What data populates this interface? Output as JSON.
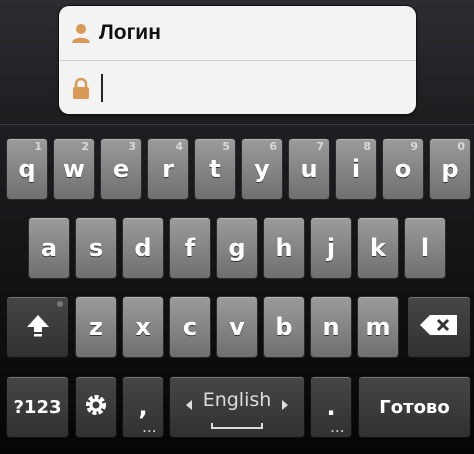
{
  "login": {
    "username_label": "Логин",
    "password_value": ""
  },
  "keyboard": {
    "row1": [
      {
        "key": "q",
        "hint": "1"
      },
      {
        "key": "w",
        "hint": "2"
      },
      {
        "key": "e",
        "hint": "3"
      },
      {
        "key": "r",
        "hint": "4"
      },
      {
        "key": "t",
        "hint": "5"
      },
      {
        "key": "y",
        "hint": "6"
      },
      {
        "key": "u",
        "hint": "7"
      },
      {
        "key": "i",
        "hint": "8"
      },
      {
        "key": "o",
        "hint": "9"
      },
      {
        "key": "p",
        "hint": "0"
      }
    ],
    "row2": [
      "a",
      "s",
      "d",
      "f",
      "g",
      "h",
      "j",
      "k",
      "l"
    ],
    "row3": [
      "z",
      "x",
      "c",
      "v",
      "b",
      "n",
      "m"
    ],
    "symbols_label": "?123",
    "comma_label": ",",
    "language_label": "English",
    "period_label": ".",
    "done_label": "Готово",
    "more_dots": "...",
    "shift_icon": "shift-arrow-icon",
    "delete_icon": "backspace-icon",
    "settings_icon": "settings-gear-icon"
  }
}
